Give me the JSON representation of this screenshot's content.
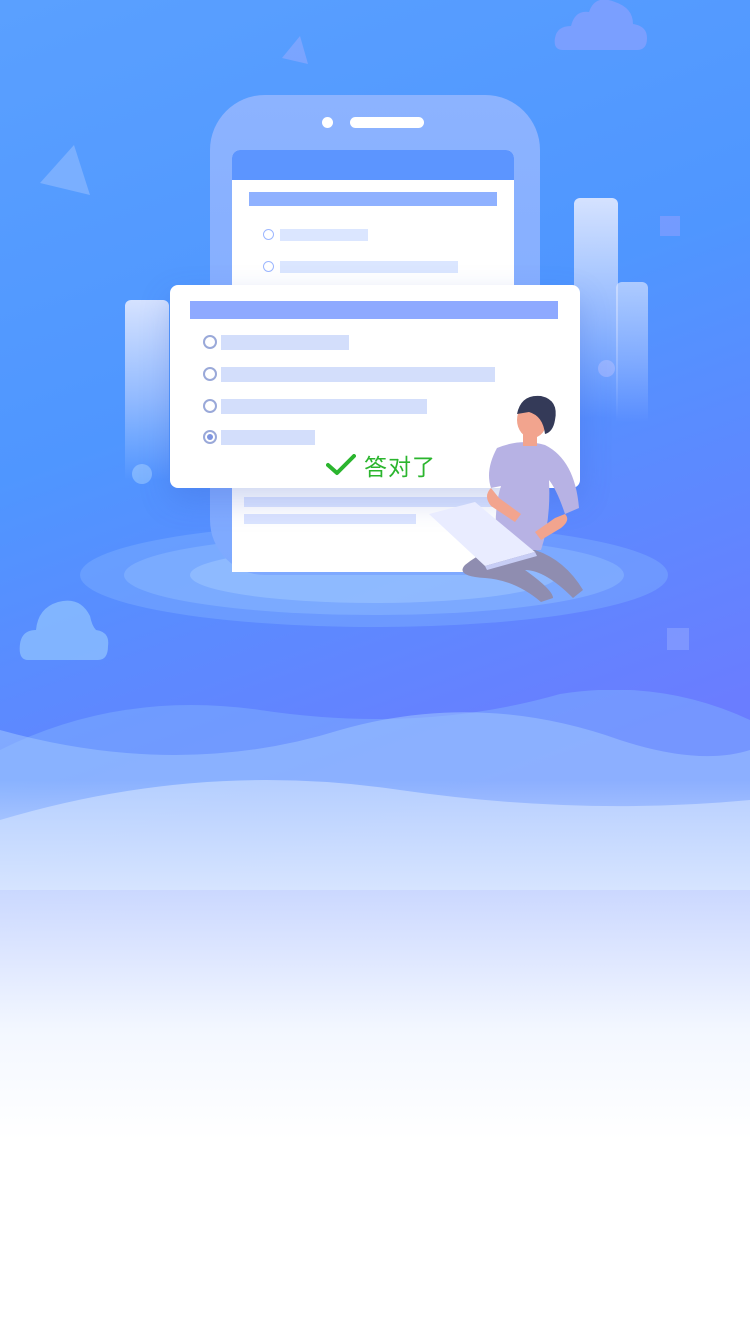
{
  "illustration": {
    "quiz_card": {
      "result_label": "答对了",
      "result_icon": "checkmark-icon",
      "options": [
        {
          "selected": false,
          "bar_fraction": 0.39
        },
        {
          "selected": false,
          "bar_fraction": 0.8
        },
        {
          "selected": false,
          "bar_fraction": 0.62
        },
        {
          "selected": true,
          "bar_fraction": 0.28
        }
      ]
    },
    "colors": {
      "background_top": "#5aa0ff",
      "background_bottom": "#6f7bff",
      "accent_green": "#2bb52e",
      "phone_body": "#8cb3ff",
      "card_header": "#8ea9ff"
    },
    "icons": [
      "cloud-icon",
      "triangle-icon",
      "square-icon",
      "phone-icon",
      "person-with-laptop-icon",
      "checkmark-icon",
      "radio-icon"
    ]
  }
}
